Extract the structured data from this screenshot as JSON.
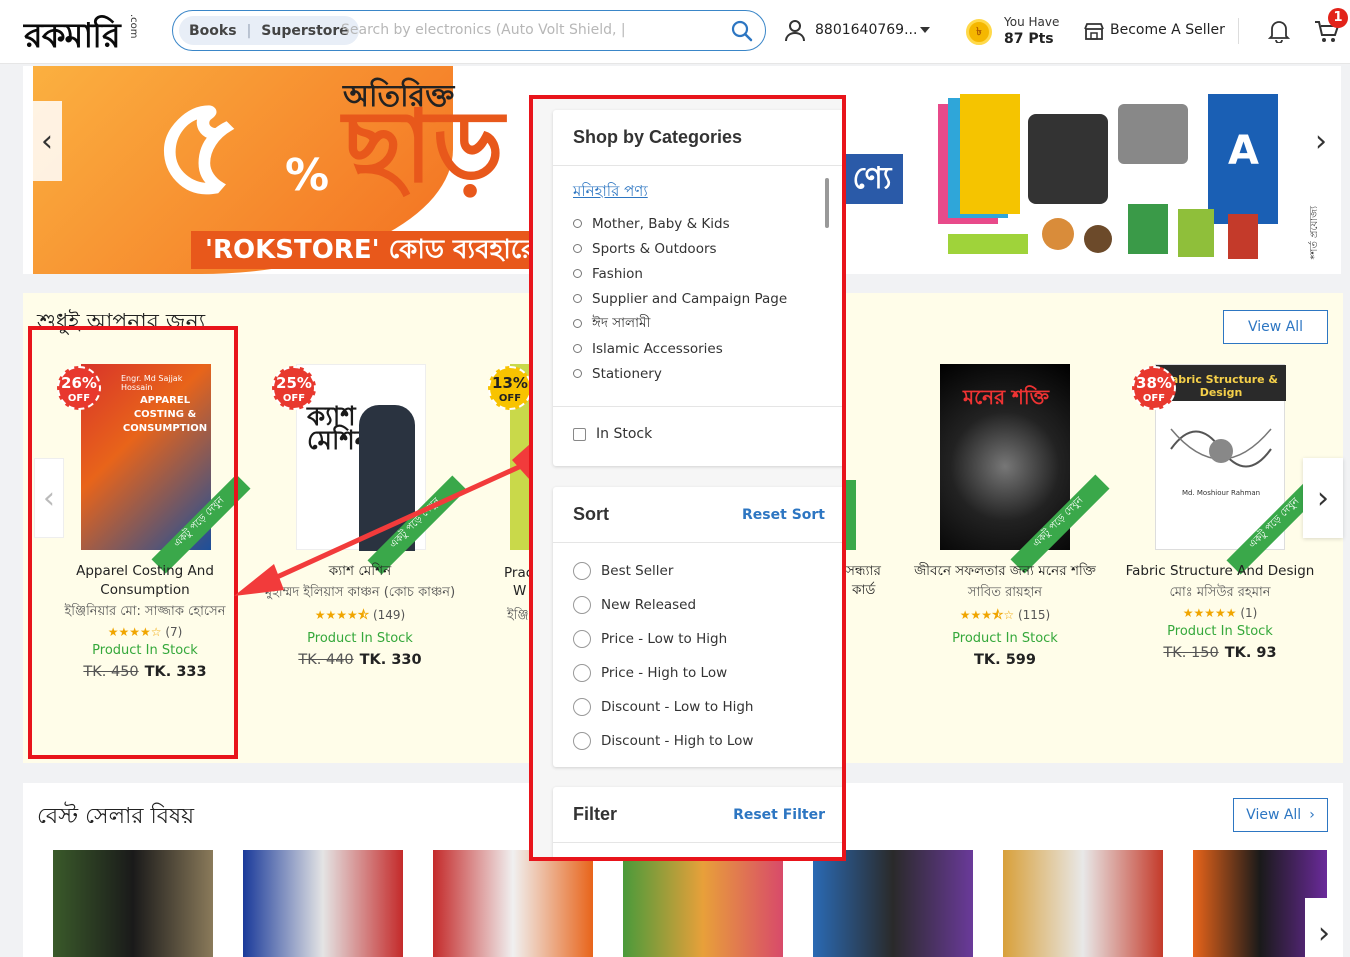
{
  "header": {
    "logo": "রকমারি",
    "logo_suffix": ".com",
    "search_seg_books": "Books",
    "search_seg_superstore": "Superstore",
    "search_placeholder": "Search by electronics (Auto Volt Shield, |",
    "phone": "8801640769...",
    "points_label": "You Have",
    "points_value": "87 Pts",
    "become_seller": "Become A Seller",
    "cart_count": "1"
  },
  "banner": {
    "number": "৫",
    "percent": "%",
    "extra": "অতিরিক্ত",
    "discount": "ছাড়",
    "code": "'ROKSTORE' কোড ব্যবহারে",
    "blue_text": "ণ্যে",
    "terms": "*শর্ত প্রযোজ্য"
  },
  "for_you": {
    "title": "শুধুই আপনার জন্য",
    "view_all": "View All",
    "products": [
      {
        "title": "Apparel Costing And Consumption",
        "author": "ইঞ্জিনিয়ার মো: সাজ্জাক হোসেন",
        "stars": "★★★★☆",
        "rating": "(7)",
        "stock": "Product In Stock",
        "old_price": "TK. 450",
        "price": "TK. 333",
        "discount": "26%",
        "cover_author": "Engr. Md Sajjak Hossain",
        "cover_title": "APPAREL COSTING & CONSUMPTION",
        "ribbon": "একটু পড়ে দেখুন"
      },
      {
        "title": "ক্যাশ মেশিন",
        "author": "মুহাম্মদ ইলিয়াস কাঞ্চন (কোচ কাঞ্চন)",
        "stars": "★★★★⯪",
        "rating": "(149)",
        "stock": "Product In Stock",
        "old_price": "TK. 440",
        "price": "TK. 330",
        "discount": "25%",
        "cover_title": "ক্যাশ মেশিন",
        "ribbon": "একটু পড়ে দেখুন"
      },
      {
        "title": "Prac",
        "title2": "W",
        "author": "ইঞ্জি",
        "discount": "13%"
      },
      {
        "title": "সন্ধ্যার",
        "title2": "কার্ড"
      },
      {
        "title": "জীবনে সফলতার জন্য মনের শক্তি",
        "author": "সাবিত রায়হান",
        "stars": "★★★⯪☆",
        "rating": "(115)",
        "stock": "Product In Stock",
        "price": "TK. 599",
        "cover_title": "মনের শক্তি",
        "ribbon": "একটু পড়ে দেখুন"
      },
      {
        "title": "Fabric Structure And Design",
        "author": "মোঃ মসিউর রহমান",
        "stars": "★★★★★",
        "rating": "(1)",
        "stock": "Product In Stock",
        "old_price": "TK. 150",
        "price": "TK. 93",
        "discount": "38%",
        "cover_title": "Fabric Structure & Design",
        "cover_author": "Md. Moshiour Rahman",
        "ribbon": "একটু পড়ে দেখুন"
      }
    ]
  },
  "best_seller": {
    "title": "বেস্ট সেলার বিষয়",
    "view_all": "View All"
  },
  "panel": {
    "categories_title": "Shop by Categories",
    "category_head": "মনিহারি পণ্য",
    "categories": [
      "Mother, Baby & Kids",
      "Sports & Outdoors",
      "Fashion",
      "Supplier and Campaign Page",
      "ঈদ সালামী",
      "Islamic Accessories",
      "Stationery"
    ],
    "in_stock": "In Stock",
    "sort_title": "Sort",
    "reset_sort": "Reset Sort",
    "sort_options": [
      "Best Seller",
      "New Released",
      "Price - Low to High",
      "Price - High to Low",
      "Discount - Low to High",
      "Discount - High to Low"
    ],
    "filter_title": "Filter",
    "reset_filter": "Reset Filter"
  },
  "colors": {
    "accent_blue": "#2d76c2",
    "highlight_red": "#e8141b",
    "stock_green": "#35a83b",
    "banner_orange": "#e8581b"
  }
}
